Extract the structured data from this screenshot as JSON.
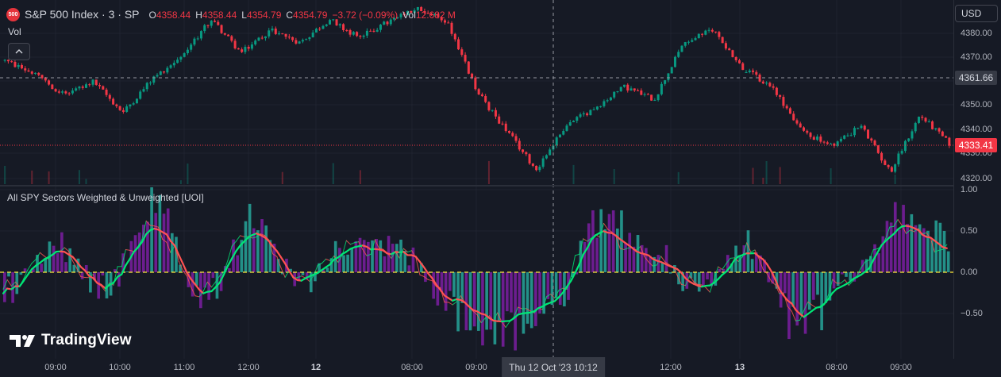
{
  "header": {
    "badge": "500",
    "symbol": "S&P 500 Index · 3 · SP",
    "ohlc": [
      {
        "k": "O",
        "v": "4358.44"
      },
      {
        "k": "H",
        "v": "4358.44"
      },
      {
        "k": "L",
        "v": "4354.79"
      },
      {
        "k": "C",
        "v": "4354.79"
      },
      {
        "k": "",
        "v": "−3.72 (−0.09%)"
      },
      {
        "k": "Vol",
        "v": "12.682 M"
      }
    ],
    "vol_label": "Vol",
    "collapse_icon": "chevron-up-icon"
  },
  "currency_button": "USD",
  "indicator": {
    "title": "All SPY Sectors Weighted & Unweighted [UOI]"
  },
  "price_axis": {
    "ticks": [
      "4380.00",
      "4370.00",
      "4360.00",
      "4350.00",
      "4340.00",
      "4330.00",
      "4320.00"
    ],
    "crosshair_label": "4361.66",
    "last_price_label": "4333.41"
  },
  "indicator_axis": {
    "ticks": [
      "1.00",
      "0.50",
      "0.00",
      "−0.50"
    ]
  },
  "time_axis": {
    "ticks": [
      {
        "label": "09:00",
        "bold": false
      },
      {
        "label": "10:00",
        "bold": false
      },
      {
        "label": "11:00",
        "bold": false
      },
      {
        "label": "12:00",
        "bold": false
      },
      {
        "label": "12",
        "bold": true
      },
      {
        "label": "08:00",
        "bold": false
      },
      {
        "label": "09:00",
        "bold": false
      },
      {
        "label": "12:00",
        "bold": false
      },
      {
        "label": "13",
        "bold": true
      },
      {
        "label": "08:00",
        "bold": false
      },
      {
        "label": "09:00",
        "bold": false
      }
    ],
    "crosshair_label": "Thu 12 Oct '23   10:12"
  },
  "logo_text": "TradingView",
  "colors": {
    "background": "#161a25",
    "up": "#089981",
    "down": "#f23645",
    "grid": "#1f2330",
    "osc_green": "#00e676",
    "osc_red": "#ff5252",
    "hist_purple": "#7b1fa2",
    "hist_teal": "#26a69a",
    "zero_line": "#ffeb3b"
  },
  "chart_data": [
    {
      "type": "candlestick",
      "title": "S&P 500 Index · 3 · SP",
      "ylim": [
        4318,
        4386
      ],
      "key_points": [
        4365,
        4360,
        4352,
        4357,
        4345,
        4358,
        4367,
        4381,
        4368,
        4377,
        4372,
        4381,
        4374,
        4380,
        4385,
        4380,
        4353,
        4338,
        4323,
        4340,
        4347,
        4355,
        4350,
        4372,
        4377,
        4362,
        4355,
        4338,
        4332,
        4340,
        4322,
        4344,
        4333
      ]
    },
    {
      "type": "line",
      "title": "All SPY Sectors Weighted & Unweighted [UOI]",
      "ylim": [
        -0.8,
        1.0
      ],
      "key_points": [
        -0.2,
        0.25,
        -0.15,
        0.55,
        -0.25,
        0.45,
        -0.1,
        0.3,
        0.25,
        -0.35,
        -0.6,
        -0.35,
        0.5,
        0.2,
        -0.2,
        0.25,
        -0.5,
        -0.1,
        0.55,
        0.3
      ]
    }
  ]
}
